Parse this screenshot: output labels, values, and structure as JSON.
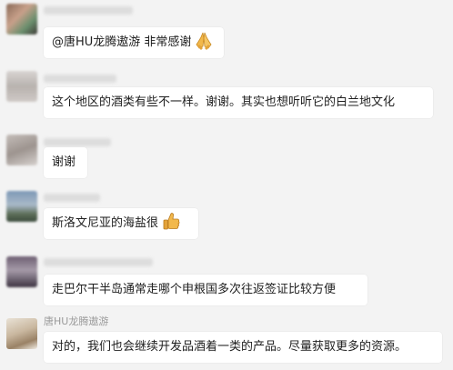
{
  "messages": [
    {
      "sender": "",
      "text": "@唐HU龙腾遨游 非常感谢",
      "emoji": "folded-hands-icon"
    },
    {
      "sender": "",
      "text": "这个地区的酒类有些不一样。谢谢。其实也想听听它的白兰地文化",
      "emoji": ""
    },
    {
      "sender": "",
      "text": "谢谢",
      "emoji": ""
    },
    {
      "sender": "",
      "text": "斯洛文尼亚的海盐很",
      "emoji": "thumbs-up-icon"
    },
    {
      "sender": "",
      "text": "走巴尔干半岛通常走哪个申根国多次往返签证比较方便",
      "emoji": ""
    },
    {
      "sender": "唐HU龙腾遨游",
      "text": "对的，我们也会继续开发品酒着一类的产品。尽量获取更多的资源。",
      "emoji": ""
    }
  ],
  "colors": {
    "background": "#f3f3f3",
    "bubble": "#ffffff",
    "sender_name": "#9a9a9a",
    "emoji_skin": "#f2b84b"
  }
}
